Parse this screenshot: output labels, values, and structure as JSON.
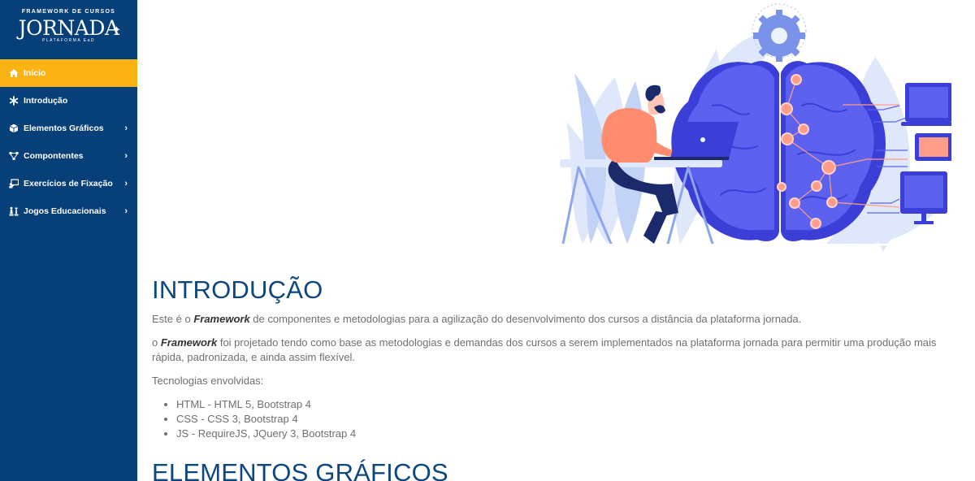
{
  "brand": {
    "top": "FRAMEWORK DE CURSOS",
    "main": "JORNADA",
    "sub": "PLATAFORMA EaD"
  },
  "sidebar": {
    "items": [
      {
        "label": "Início",
        "icon": "home-icon",
        "active": true,
        "submenu": false
      },
      {
        "label": "Introdução",
        "icon": "asterisk-icon",
        "active": false,
        "submenu": false
      },
      {
        "label": "Elementos Gráficos",
        "icon": "cube-icon",
        "active": false,
        "submenu": true
      },
      {
        "label": "Compontentes",
        "icon": "nodes-icon",
        "active": false,
        "submenu": true
      },
      {
        "label": "Exercícios de Fixação",
        "icon": "exercise-icon",
        "active": false,
        "submenu": true
      },
      {
        "label": "Jogos Educacionais",
        "icon": "chess-icon",
        "active": false,
        "submenu": true
      }
    ],
    "chevron": "›"
  },
  "main": {
    "intro_title": "INTRODUÇÃO",
    "p1_before": "Este é o ",
    "p1_bold": "Framework",
    "p1_after": " de componentes e metodologias para a agilização do desenvolvimento dos cursos a distância da plataforma jornada.",
    "p2_before": "o ",
    "p2_bold": "Framework",
    "p2_after": " foi projetado tendo como base as metodologias e demandas dos cursos a serem implementados na plataforma jornada para permitir uma produção mais rápida, padronizada, e ainda assim flexível.",
    "tech_label": "Tecnologias envolvidas:",
    "tech_list": [
      "HTML - HTML 5, Bootstrap 4",
      "CSS - CSS 3, Bootstrap 4",
      "JS - RequireJS, JQuery 3, Bootstrap 4"
    ],
    "next_title": "ELEMENTOS GRÁFICOS"
  },
  "colors": {
    "sidebar_bg": "#073f78",
    "active_bg": "#fbb313",
    "heading": "#0e4680",
    "text": "#6f6f6f"
  }
}
